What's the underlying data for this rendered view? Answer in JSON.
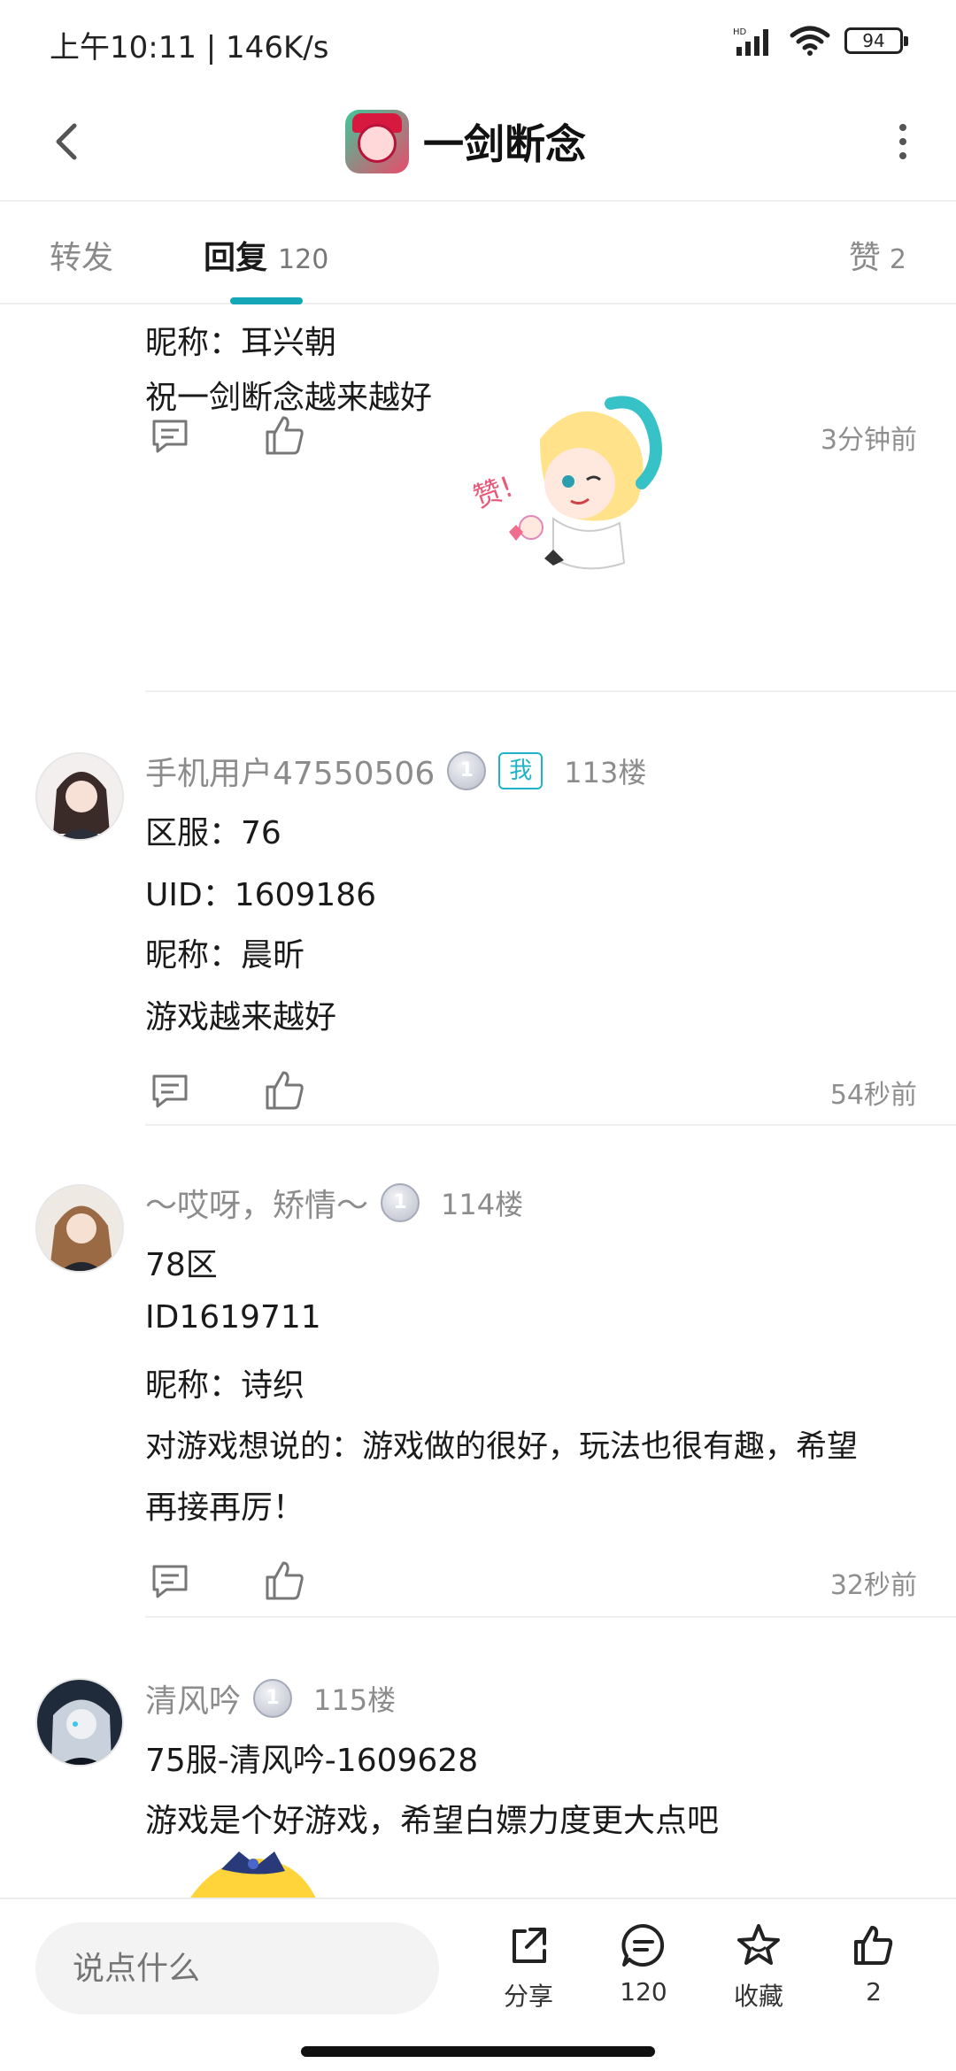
{
  "status_bar": {
    "time": "上午10:11 | 146K/s",
    "battery": "94"
  },
  "header": {
    "title": "一剑断念"
  },
  "tabs": [
    {
      "label": "转发",
      "count": ""
    },
    {
      "label": "回复",
      "count": "120"
    },
    {
      "label": "赞",
      "count": "2"
    }
  ],
  "posts": [
    {
      "lines": [
        "昵称：耳兴朝",
        "祝一剑断念越来越好"
      ],
      "time": "3分钟前"
    },
    {
      "username": "手机用户47550506",
      "level": "1",
      "tag": "我",
      "floor": "113楼",
      "lines": [
        "区服：76",
        "UID：1609186",
        "昵称：晨昕",
        "游戏越来越好"
      ],
      "time": "54秒前"
    },
    {
      "username": "～哎呀，矫情～",
      "level": "1",
      "floor": "114楼",
      "lines": [
        "78区",
        "ID1619711",
        "昵称：诗织",
        "对游戏想说的：游戏做的很好，玩法也很有趣，希望",
        "再接再厉！"
      ],
      "time": "32秒前"
    },
    {
      "username": "清风吟",
      "level": "1",
      "floor": "115楼",
      "lines": [
        "75服-清风吟-1609628",
        "游戏是个好游戏，希望白嫖力度更大点吧"
      ]
    }
  ],
  "bottom_bar": {
    "input_placeholder": "说点什么",
    "share_label": "分享",
    "comment_count": "120",
    "favorite_label": "收藏",
    "like_count": "2"
  },
  "colors": {
    "accent": "#15a6b8",
    "text_secondary": "#8c8c8c"
  }
}
